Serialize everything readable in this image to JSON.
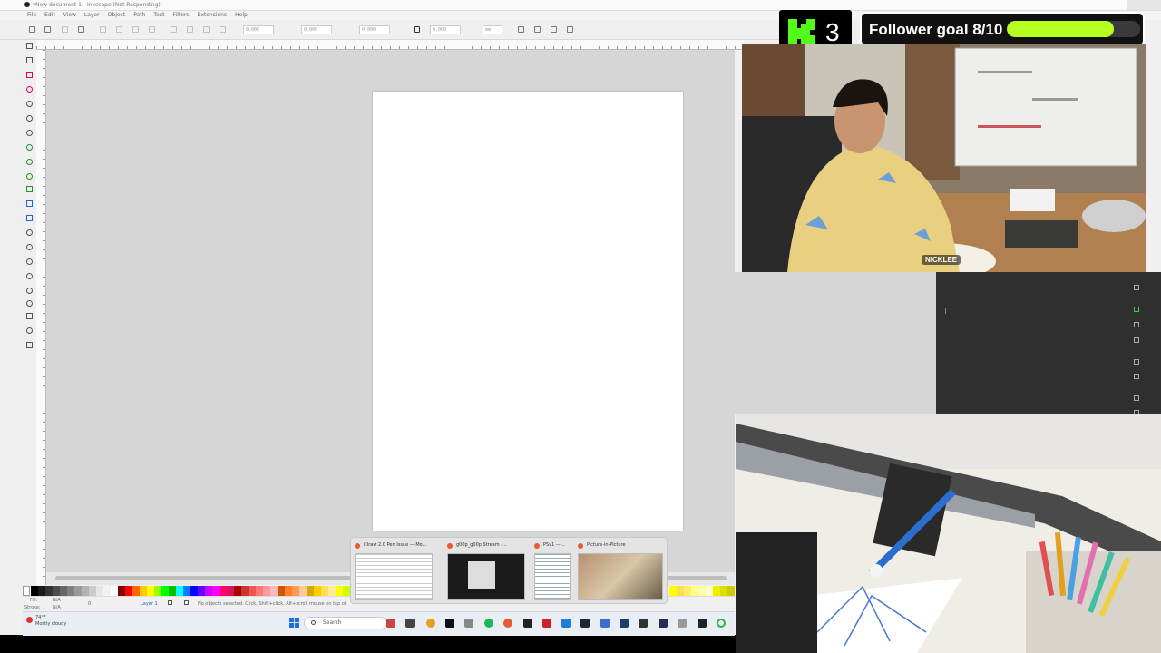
{
  "window": {
    "title": "*New document 1 - Inkscape (Not Responding)",
    "menus": [
      "File",
      "Edit",
      "View",
      "Layer",
      "Object",
      "Path",
      "Text",
      "Filters",
      "Extensions",
      "Help"
    ]
  },
  "toolbar": {
    "x_field": "0.000",
    "y_field": "0.000",
    "w_field": "0.000",
    "h_field": "0.000",
    "unit": "mm"
  },
  "statusbar": {
    "fill_label": "Fill:",
    "fill_value": "N/A",
    "stroke_label": "Stroke:",
    "stroke_value": "N/A",
    "opacity_value": "0",
    "layer": "Layer 1",
    "message": "No objects selected. Click, Shift+click, Alt+scroll mouse on top of objects, or drag around objects to select."
  },
  "taskbar": {
    "weather_temp": "74°F",
    "weather_desc": "Mostly cloudy",
    "search_placeholder": "Search"
  },
  "thumbnails": [
    {
      "title": "iDraw 2.0 Pen Issue — Mo..."
    },
    {
      "title": "g00p_g00p Stream -..."
    },
    {
      "title": "PSv1 —..."
    },
    {
      "title": "Picture-in-Picture"
    }
  ],
  "overlay": {
    "kick_count": "3",
    "follower_goal_text": "Follower goal 8/10",
    "follower_progress": 0.8,
    "streamer_tag": "NICKLEE"
  },
  "colors": {
    "kick_green": "#53fc18",
    "goal_fill": "#b6ff1f",
    "canvas_bg": "#d6d6d6",
    "dock_bg": "#2f2f2f"
  },
  "icons": {
    "app": "inkscape-icon",
    "dock_panels": [
      "document-properties-icon",
      "xml-editor-icon",
      "layers-icon",
      "objects-icon",
      "align-icon",
      "transform-icon",
      "fill-stroke-icon",
      "text-icon"
    ]
  }
}
